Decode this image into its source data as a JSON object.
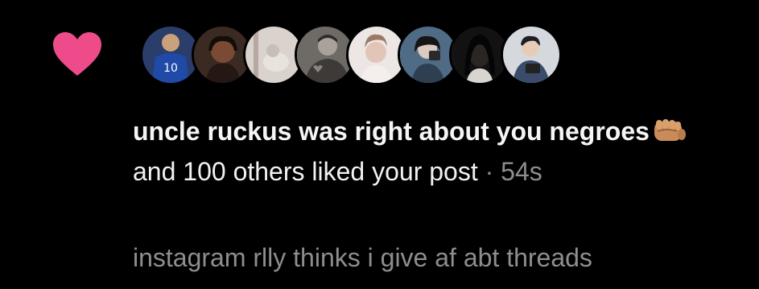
{
  "notification": {
    "type_icon": "heart-icon",
    "heart_color": "#ee4b8b",
    "avatars": [
      {
        "label": "avatar-1"
      },
      {
        "label": "avatar-2"
      },
      {
        "label": "avatar-3"
      },
      {
        "label": "avatar-4"
      },
      {
        "label": "avatar-5"
      },
      {
        "label": "avatar-6"
      },
      {
        "label": "avatar-7"
      },
      {
        "label": "avatar-8"
      }
    ],
    "jersey_number": "10",
    "username": "uncle ruckus was right about you negroes",
    "username_emoji": "oncoming-fist-emoji",
    "action_text": " and 100 others liked your post",
    "separator": " · ",
    "timestamp": "54s"
  },
  "caption": "instagram rlly thinks i give af abt threads"
}
